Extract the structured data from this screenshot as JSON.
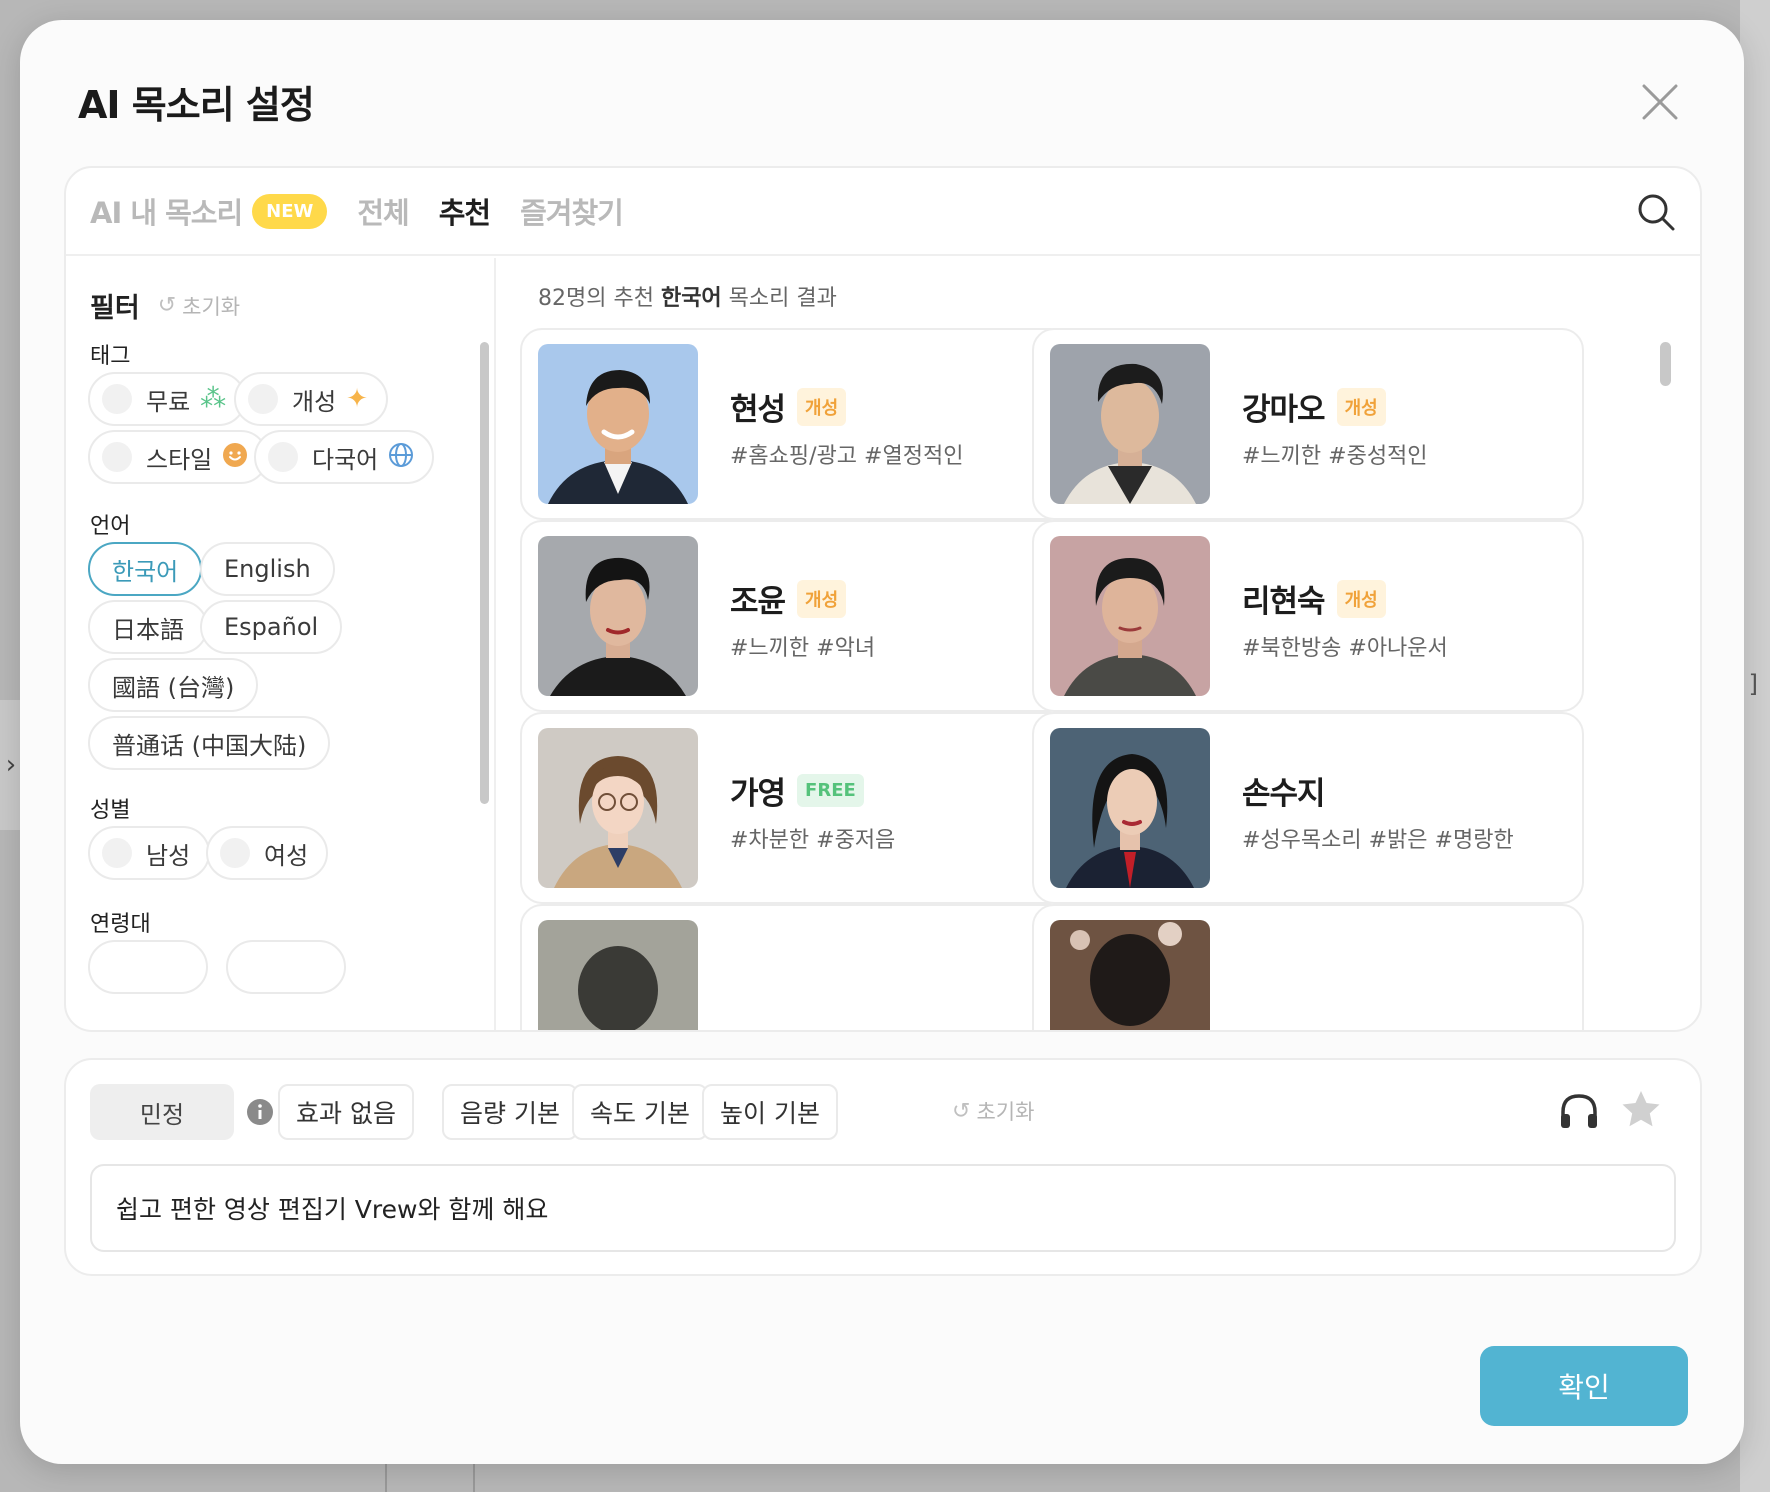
{
  "modal": {
    "title": "AI 목소리 설정",
    "confirm_label": "확인"
  },
  "tabs": [
    {
      "label": "AI 내 목소리",
      "badge": "NEW",
      "active": false
    },
    {
      "label": "전체",
      "active": false
    },
    {
      "label": "추천",
      "active": true
    },
    {
      "label": "즐겨찾기",
      "active": false
    }
  ],
  "filter": {
    "title": "필터",
    "reset_label": "초기화",
    "sections": {
      "tag": "태그",
      "language": "언어",
      "gender": "성별",
      "age": "연령대"
    },
    "tags": [
      {
        "label": "무료",
        "icon": "sparkle-icon"
      },
      {
        "label": "개성",
        "icon": "star-sparkle-icon"
      },
      {
        "label": "스타일",
        "icon": "smiley-icon"
      },
      {
        "label": "다국어",
        "icon": "globe-icon"
      }
    ],
    "languages": [
      {
        "label": "한국어",
        "selected": true
      },
      {
        "label": "English",
        "selected": false
      },
      {
        "label": "日本語",
        "selected": false
      },
      {
        "label": "Español",
        "selected": false
      },
      {
        "label": "國語 (台灣)",
        "selected": false
      },
      {
        "label": "普通话 (中国大陆)",
        "selected": false
      }
    ],
    "genders": [
      {
        "label": "남성"
      },
      {
        "label": "여성"
      }
    ]
  },
  "results": {
    "count_prefix": "82명의 추천 ",
    "count_lang": "한국어",
    "count_suffix": " 목소리 결과",
    "voices": [
      {
        "name": "현성",
        "badge": "개성",
        "badge_type": "gaesung",
        "tags": "#홈쇼핑/광고 #열정적인",
        "bg": "#a9c8ec"
      },
      {
        "name": "강마오",
        "badge": "개성",
        "badge_type": "gaesung",
        "tags": "#느끼한 #중성적인",
        "bg": "#9ea3ab"
      },
      {
        "name": "조윤",
        "badge": "개성",
        "badge_type": "gaesung",
        "tags": "#느끼한 #악녀",
        "bg": "#a6a9ad"
      },
      {
        "name": "리현숙",
        "badge": "개성",
        "badge_type": "gaesung",
        "tags": "#북한방송 #아나운서",
        "bg": "#c7a3a3"
      },
      {
        "name": "가영",
        "badge": "FREE",
        "badge_type": "free",
        "tags": "#차분한 #중저음",
        "bg": "#cfcac4"
      },
      {
        "name": "손수지",
        "badge": "",
        "badge_type": "",
        "tags": "#성우목소리 #밝은 #명랑한",
        "bg": "#4d6375"
      }
    ]
  },
  "controls": {
    "voice_name": "민정",
    "effect": "효과 없음",
    "volume": "음량 기본",
    "speed": "속도 기본",
    "pitch": "높이 기본",
    "reset_label": "초기화",
    "text_value": "쉽고 편한 영상 편집기 Vrew와 함께 해요"
  },
  "colors": {
    "accent": "#52b4d2",
    "selected_border": "#4ba7c3",
    "new_badge": "#ffd94a",
    "gaesung_text": "#f0a23a",
    "free_text": "#55c27b"
  }
}
